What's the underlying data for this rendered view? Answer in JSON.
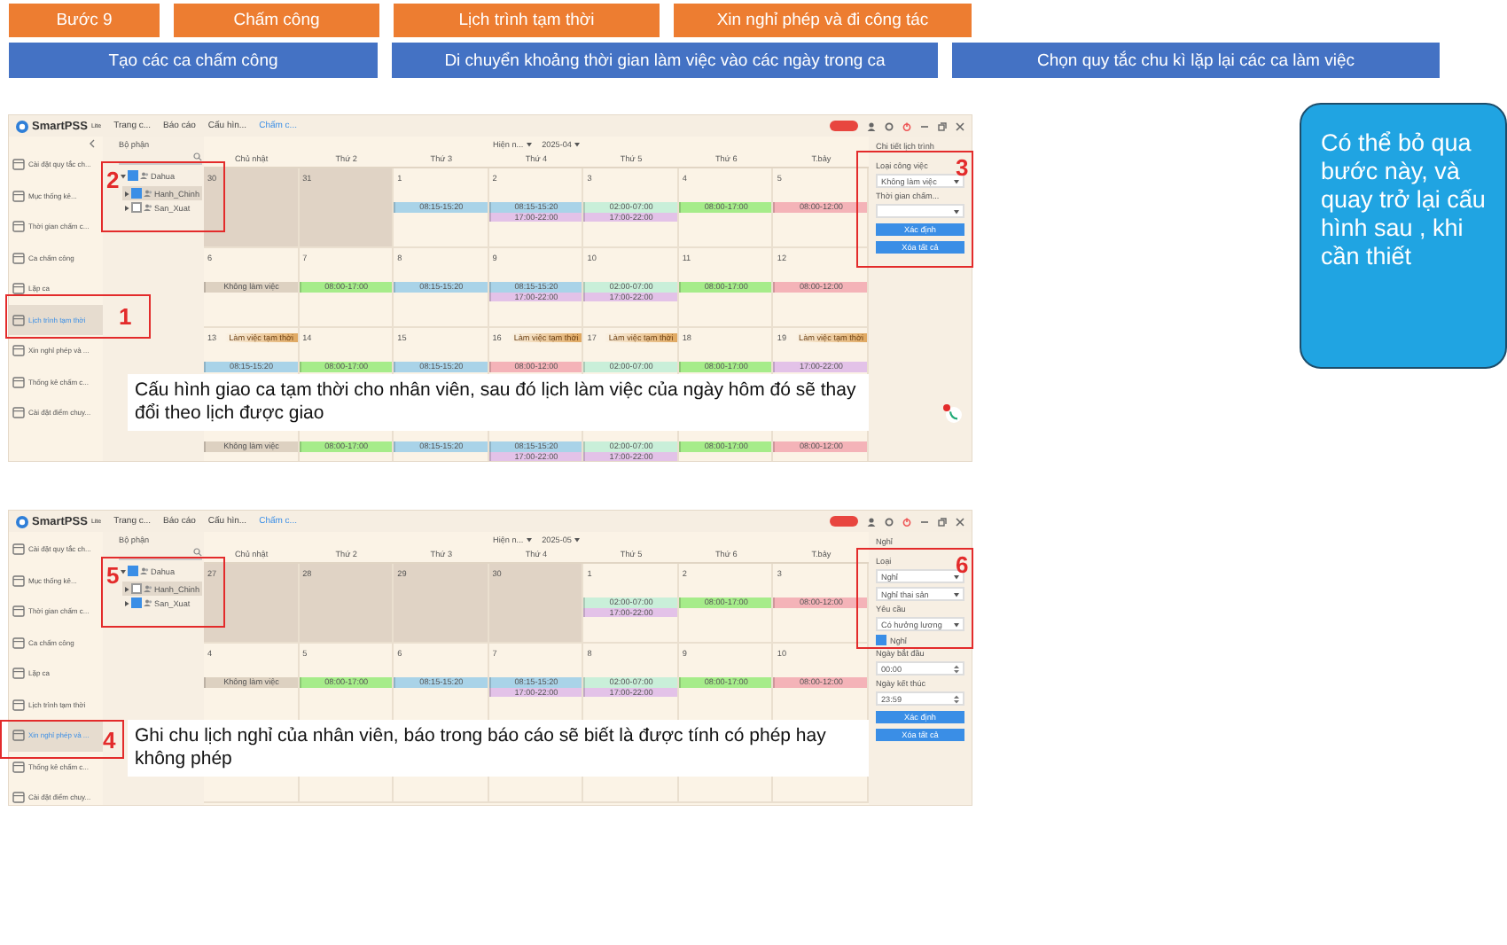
{
  "steps_top": [
    {
      "label": "Bước 9"
    },
    {
      "label": "Chấm công"
    },
    {
      "label": "Lịch trình tạm thời"
    },
    {
      "label": "Xin nghỉ phép và đi công tác"
    }
  ],
  "steps_bottom": [
    {
      "label": "Tạo các ca chấm công"
    },
    {
      "label": "Di chuyển khoảng thời gian làm việc vào các ngày trong ca"
    },
    {
      "label": "Chọn quy tắc chu kì lặp lại các ca làm việc"
    }
  ],
  "note": "Có thể bỏ qua bước này, và quay trở lại cấu hình sau , khi cần thiết",
  "screens": [
    {
      "brand": "SmartPSS",
      "brand_sup": "Lite",
      "menus": [
        {
          "label": "Trang c...",
          "selected": false
        },
        {
          "label": "Báo cáo",
          "selected": false
        },
        {
          "label": "Cấu hìn...",
          "selected": false
        },
        {
          "label": "Chấm c...",
          "selected": true
        }
      ],
      "sidebar": [
        {
          "label": "Cài đặt quy tắc ch...",
          "selected": false
        },
        {
          "label": "Mục thống kê...",
          "selected": false
        },
        {
          "label": "Thời gian chấm c...",
          "selected": false
        },
        {
          "label": "Ca chấm công",
          "selected": false
        },
        {
          "label": "Lặp ca",
          "selected": false
        },
        {
          "label": "Lịch trình tạm thời",
          "selected": true
        },
        {
          "label": "Xin nghỉ phép và ...",
          "selected": false
        },
        {
          "label": "Thống kê chấm c...",
          "selected": false
        },
        {
          "label": "Cài đặt điểm chuy...",
          "selected": false
        }
      ],
      "tree_header": "Bộ phận",
      "tree": [
        {
          "label": "Dahua",
          "checked": true,
          "expanded": true,
          "selected": false,
          "children": [
            {
              "label": "Hanh_Chinh",
              "checked": true,
              "expanded": false,
              "selected": true
            },
            {
              "label": "San_Xuat",
              "checked": false,
              "expanded": false,
              "selected": false
            }
          ]
        }
      ],
      "filter": {
        "mode": "Hiện n...",
        "month": "2025-04"
      },
      "weekdays": [
        "Chủ nhật",
        "Thứ 2",
        "Thứ 3",
        "Thứ 4",
        "Thứ 5",
        "Thứ 6",
        "T.bảy"
      ],
      "weeks": [
        {
          "days": [
            {
              "day": "30",
              "outside": true
            },
            {
              "day": "31",
              "outside": true
            },
            {
              "day": "1",
              "outside": false,
              "shifts": [
                {
                  "time": "08:15-15:20",
                  "color": "#a9d3e8"
                }
              ]
            },
            {
              "day": "2",
              "outside": false,
              "shifts": [
                {
                  "time": "08:15-15:20",
                  "color": "#a9d3e8"
                },
                {
                  "time": "17:00-22:00",
                  "color": "#e3c2e8"
                }
              ]
            },
            {
              "day": "3",
              "outside": false,
              "shifts": [
                {
                  "time": "02:00-07:00",
                  "color": "#c9efd9"
                },
                {
                  "time": "17:00-22:00",
                  "color": "#e3c2e8"
                }
              ]
            },
            {
              "day": "4",
              "outside": false,
              "shifts": [
                {
                  "time": "08:00-17:00",
                  "color": "#a6ec8a"
                }
              ]
            },
            {
              "day": "5",
              "outside": false,
              "shifts": [
                {
                  "time": "08:00-12:00",
                  "color": "#f4b3b8"
                }
              ]
            }
          ]
        },
        {
          "days": [
            {
              "day": "6",
              "outside": false,
              "shifts": [
                {
                  "time": "Không làm việc",
                  "color": "#ddd1c1"
                }
              ]
            },
            {
              "day": "7",
              "outside": false,
              "shifts": [
                {
                  "time": "08:00-17:00",
                  "color": "#a6ec8a"
                }
              ]
            },
            {
              "day": "8",
              "outside": false,
              "shifts": [
                {
                  "time": "08:15-15:20",
                  "color": "#a9d3e8"
                }
              ]
            },
            {
              "day": "9",
              "outside": false,
              "shifts": [
                {
                  "time": "08:15-15:20",
                  "color": "#a9d3e8"
                },
                {
                  "time": "17:00-22:00",
                  "color": "#e3c2e8"
                }
              ]
            },
            {
              "day": "10",
              "outside": false,
              "shifts": [
                {
                  "time": "02:00-07:00",
                  "color": "#c9efd9"
                },
                {
                  "time": "17:00-22:00",
                  "color": "#e3c2e8"
                }
              ]
            },
            {
              "day": "11",
              "outside": false,
              "shifts": [
                {
                  "time": "08:00-17:00",
                  "color": "#a6ec8a"
                }
              ]
            },
            {
              "day": "12",
              "outside": false,
              "shifts": [
                {
                  "time": "08:00-12:00",
                  "color": "#f4b3b8"
                }
              ]
            }
          ]
        },
        {
          "days": [
            {
              "day": "13",
              "outside": false,
              "badge": "Làm việc tạm thời",
              "shifts": [
                {
                  "time": "08:15-15:20",
                  "color": "#a9d3e8"
                }
              ]
            },
            {
              "day": "14",
              "outside": false,
              "shifts": [
                {
                  "time": "08:00-17:00",
                  "color": "#a6ec8a"
                }
              ]
            },
            {
              "day": "15",
              "outside": false,
              "shifts": [
                {
                  "time": "08:15-15:20",
                  "color": "#a9d3e8"
                }
              ]
            },
            {
              "day": "16",
              "outside": false,
              "badge": "Làm việc tạm thời",
              "shifts": [
                {
                  "time": "08:00-12:00",
                  "color": "#f4b3b8"
                }
              ]
            },
            {
              "day": "17",
              "outside": false,
              "badge": "Làm việc tạm thời",
              "shifts": [
                {
                  "time": "02:00-07:00",
                  "color": "#c9efd9"
                }
              ]
            },
            {
              "day": "18",
              "outside": false,
              "shifts": [
                {
                  "time": "08:00-17:00",
                  "color": "#a6ec8a"
                }
              ]
            },
            {
              "day": "19",
              "outside": false,
              "badge": "Làm việc tạm thời",
              "shifts": [
                {
                  "time": "17:00-22:00",
                  "color": "#e3c2e8"
                }
              ]
            }
          ]
        },
        {
          "days": [
            {
              "outside": false,
              "shifts": [
                {
                  "time": "Không làm việc",
                  "color": "#ddd1c1"
                }
              ]
            },
            {
              "outside": false,
              "shifts": [
                {
                  "time": "08:00-17:00",
                  "color": "#a6ec8a"
                }
              ]
            },
            {
              "outside": false,
              "shifts": [
                {
                  "time": "08:15-15:20",
                  "color": "#a9d3e8"
                }
              ]
            },
            {
              "outside": false,
              "shifts": [
                {
                  "time": "08:15-15:20",
                  "color": "#a9d3e8"
                },
                {
                  "time": "17:00-22:00",
                  "color": "#e3c2e8"
                }
              ]
            },
            {
              "outside": false,
              "shifts": [
                {
                  "time": "02:00-07:00",
                  "color": "#c9efd9"
                },
                {
                  "time": "17:00-22:00",
                  "color": "#e3c2e8"
                }
              ]
            },
            {
              "outside": false,
              "shifts": [
                {
                  "time": "08:00-17:00",
                  "color": "#a6ec8a"
                }
              ]
            },
            {
              "outside": false,
              "shifts": [
                {
                  "time": "08:00-12:00",
                  "color": "#f4b3b8"
                }
              ]
            }
          ]
        }
      ],
      "panel": [
        {
          "kind": "title",
          "text": "Chi tiết lịch trình"
        },
        {
          "kind": "label",
          "text": "Loại công việc"
        },
        {
          "kind": "select",
          "text": "Không làm việc"
        },
        {
          "kind": "label",
          "text": "Thời gian chấm..."
        },
        {
          "kind": "select"
        },
        {
          "kind": "button",
          "text": "Xác định"
        },
        {
          "kind": "button",
          "text": "Xóa tất cả"
        }
      ],
      "callouts": [
        {
          "number": "1",
          "kind": "sidebar"
        },
        {
          "number": "2",
          "kind": "tree"
        },
        {
          "number": "3",
          "kind": "panel"
        }
      ],
      "caption": "Cấu hình giao ca tạm thời cho nhân viên, sau đó lịch làm việc của ngày hôm đó sẽ thay đổi theo lịch được giao"
    },
    {
      "brand": "SmartPSS",
      "brand_sup": "Lite",
      "menus": [
        {
          "label": "Trang c...",
          "selected": false
        },
        {
          "label": "Báo cáo",
          "selected": false
        },
        {
          "label": "Cấu hìn...",
          "selected": false
        },
        {
          "label": "Chấm c...",
          "selected": true
        }
      ],
      "sidebar": [
        {
          "label": "Cài đặt quy tắc ch...",
          "selected": false
        },
        {
          "label": "Mục thống kê...",
          "selected": false
        },
        {
          "label": "Thời gian chấm c...",
          "selected": false
        },
        {
          "label": "Ca chấm công",
          "selected": false
        },
        {
          "label": "Lặp ca",
          "selected": false
        },
        {
          "label": "Lịch trình tạm thời",
          "selected": false
        },
        {
          "label": "Xin nghỉ phép và ...",
          "selected": true
        },
        {
          "label": "Thống kê chấm c...",
          "selected": false
        },
        {
          "label": "Cài đặt điểm chuy...",
          "selected": false
        }
      ],
      "tree_header": "Bộ phận",
      "tree": [
        {
          "label": "Dahua",
          "checked": true,
          "expanded": true,
          "selected": false,
          "children": [
            {
              "label": "Hanh_Chinh",
              "checked": false,
              "expanded": false,
              "selected": true
            },
            {
              "label": "San_Xuat",
              "checked": true,
              "expanded": false,
              "selected": false
            }
          ]
        }
      ],
      "filter": {
        "mode": "Hiện n...",
        "month": "2025-05"
      },
      "weekdays": [
        "Chủ nhật",
        "Thứ 2",
        "Thứ 3",
        "Thứ 4",
        "Thứ 5",
        "Thứ 6",
        "T.bảy"
      ],
      "weeks": [
        {
          "days": [
            {
              "day": "27",
              "outside": true
            },
            {
              "day": "28",
              "outside": true
            },
            {
              "day": "29",
              "outside": true
            },
            {
              "day": "30",
              "outside": true
            },
            {
              "day": "1",
              "outside": false,
              "shifts": [
                {
                  "time": "02:00-07:00",
                  "color": "#c9efd9"
                },
                {
                  "time": "17:00-22:00",
                  "color": "#e3c2e8"
                }
              ]
            },
            {
              "day": "2",
              "outside": false,
              "shifts": [
                {
                  "time": "08:00-17:00",
                  "color": "#a6ec8a"
                }
              ]
            },
            {
              "day": "3",
              "outside": false,
              "shifts": [
                {
                  "time": "08:00-12:00",
                  "color": "#f4b3b8"
                }
              ]
            }
          ]
        },
        {
          "days": [
            {
              "day": "4",
              "outside": false,
              "shifts": [
                {
                  "time": "Không làm việc",
                  "color": "#ddd1c1"
                }
              ]
            },
            {
              "day": "5",
              "outside": false,
              "shifts": [
                {
                  "time": "08:00-17:00",
                  "color": "#a6ec8a"
                }
              ]
            },
            {
              "day": "6",
              "outside": false,
              "shifts": [
                {
                  "time": "08:15-15:20",
                  "color": "#a9d3e8"
                }
              ]
            },
            {
              "day": "7",
              "outside": false,
              "shifts": [
                {
                  "time": "08:15-15:20",
                  "color": "#a9d3e8"
                },
                {
                  "time": "17:00-22:00",
                  "color": "#e3c2e8"
                }
              ]
            },
            {
              "day": "8",
              "outside": false,
              "shifts": [
                {
                  "time": "02:00-07:00",
                  "color": "#c9efd9"
                },
                {
                  "time": "17:00-22:00",
                  "color": "#e3c2e8"
                }
              ]
            },
            {
              "day": "9",
              "outside": false,
              "shifts": [
                {
                  "time": "08:00-17:00",
                  "color": "#a6ec8a"
                }
              ]
            },
            {
              "day": "10",
              "outside": false,
              "shifts": [
                {
                  "time": "08:00-12:00",
                  "color": "#f4b3b8"
                }
              ]
            }
          ]
        },
        {
          "days": [
            {
              "outside": false
            },
            {
              "outside": false
            },
            {
              "outside": false
            },
            {
              "outside": false
            },
            {
              "outside": false
            },
            {
              "outside": false
            },
            {
              "outside": false
            }
          ]
        }
      ],
      "panel": [
        {
          "kind": "title",
          "text": "Nghỉ"
        },
        {
          "kind": "label",
          "text": "Loại"
        },
        {
          "kind": "select",
          "text": "Nghỉ"
        },
        {
          "kind": "select",
          "text": "Nghỉ thai sản"
        },
        {
          "kind": "label",
          "text": "Yêu cầu"
        },
        {
          "kind": "select",
          "text": "Có hưởng lương"
        },
        {
          "kind": "checkbox",
          "text": "Nghỉ",
          "checked": true
        },
        {
          "kind": "label",
          "text": "Ngày bắt đầu"
        },
        {
          "kind": "field",
          "text": "00:00"
        },
        {
          "kind": "label",
          "text": "Ngày kết thúc"
        },
        {
          "kind": "field",
          "text": "23:59"
        },
        {
          "kind": "button",
          "text": "Xác định"
        },
        {
          "kind": "button",
          "text": "Xóa tất cả"
        }
      ],
      "callouts": [
        {
          "number": "4",
          "kind": "sidebar"
        },
        {
          "number": "5",
          "kind": "tree"
        },
        {
          "number": "6",
          "kind": "panel"
        }
      ],
      "caption": "Ghi chu lịch nghỉ của nhân viên, báo trong báo cáo sẽ biết là được tính có phép hay không phép"
    }
  ]
}
